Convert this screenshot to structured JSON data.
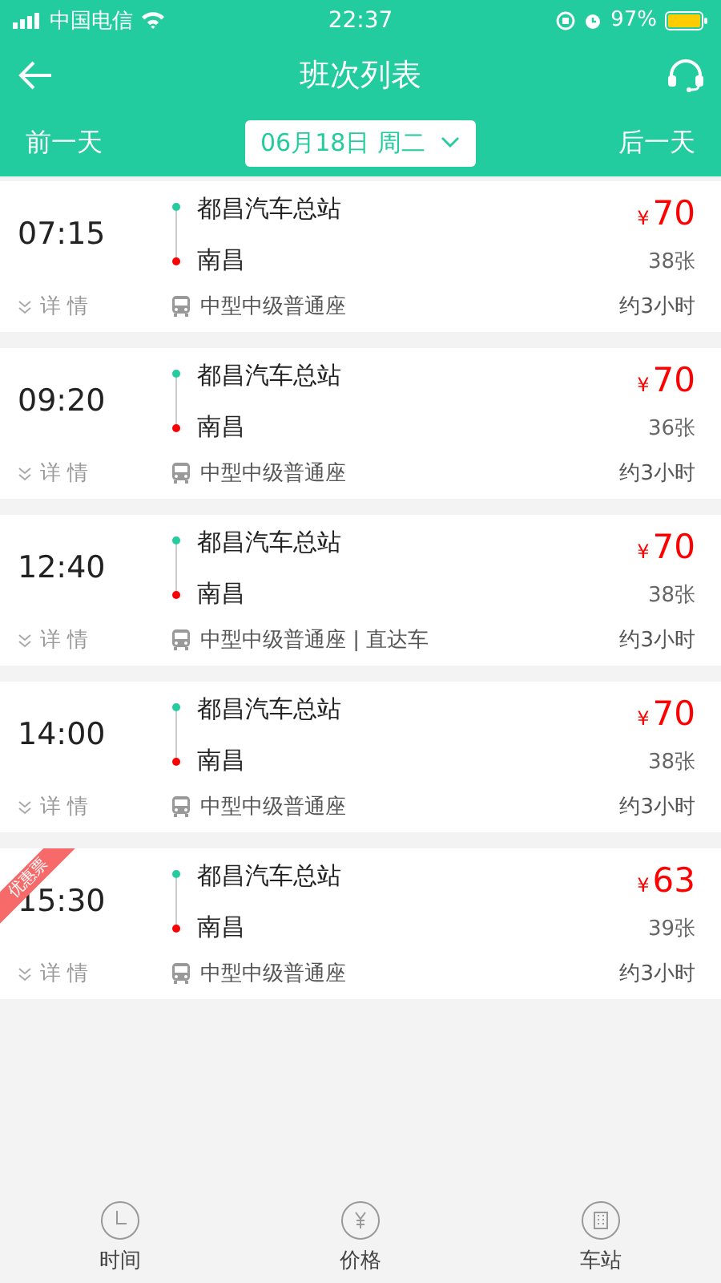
{
  "status_bar": {
    "carrier": "中国电信",
    "time": "22:37",
    "battery": "97%"
  },
  "header": {
    "title": "班次列表"
  },
  "date_bar": {
    "prev": "前一天",
    "date": "06月18日 周二",
    "next": "后一天"
  },
  "trips": [
    {
      "time": "07:15",
      "from": "都昌汽车总站",
      "to": "南昌",
      "currency": "¥",
      "price": "70",
      "seats": "38张",
      "details": "详 情",
      "bus_type": "中型中级普通座",
      "duration": "约3小时"
    },
    {
      "time": "09:20",
      "from": "都昌汽车总站",
      "to": "南昌",
      "currency": "¥",
      "price": "70",
      "seats": "36张",
      "details": "详 情",
      "bus_type": "中型中级普通座",
      "duration": "约3小时"
    },
    {
      "time": "12:40",
      "from": "都昌汽车总站",
      "to": "南昌",
      "currency": "¥",
      "price": "70",
      "seats": "38张",
      "details": "详 情",
      "bus_type": "中型中级普通座 | 直达车",
      "duration": "约3小时"
    },
    {
      "time": "14:00",
      "from": "都昌汽车总站",
      "to": "南昌",
      "currency": "¥",
      "price": "70",
      "seats": "38张",
      "details": "详 情",
      "bus_type": "中型中级普通座",
      "duration": "约3小时"
    },
    {
      "time": "15:30",
      "from": "都昌汽车总站",
      "to": "南昌",
      "currency": "¥",
      "price": "63",
      "seats": "39张",
      "details": "详 情",
      "bus_type": "中型中级普通座",
      "duration": "约3小时",
      "badge": "优惠票"
    }
  ],
  "sort_tabs": [
    {
      "kind": "time",
      "label": "时间",
      "selected": false
    },
    {
      "kind": "price",
      "label": "价格",
      "selected": false
    },
    {
      "kind": "station",
      "label": "车站",
      "selected": false
    }
  ]
}
